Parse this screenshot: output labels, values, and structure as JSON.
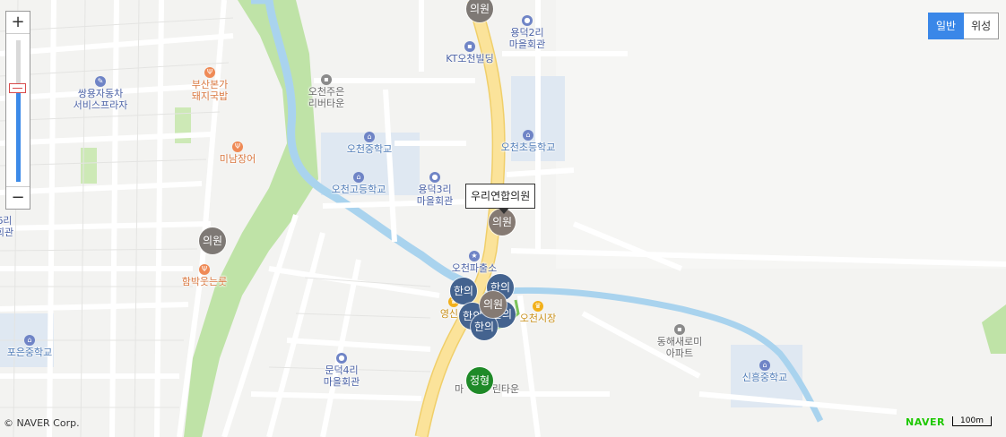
{
  "map_type": {
    "normal": "일반",
    "satellite": "위성"
  },
  "zoom": {
    "zoom_in": "+",
    "zoom_out": "−"
  },
  "copyright": "© NAVER Corp.",
  "brand": "NAVER",
  "scale_label": "100m",
  "tooltip": "우리연합의원",
  "colors": {
    "accent": "#3a87e8",
    "water": "#a9d3ee",
    "park": "#bfe3a7",
    "main_road": "#fbe39a"
  },
  "pois": [
    {
      "id": "ssangyong",
      "line1": "쌍용자동차",
      "line2": "서비스프라자",
      "icon": "wrench-icon",
      "color": "blue"
    },
    {
      "id": "busan",
      "line1": "부산본가",
      "line2": "돼지국밥",
      "icon": "fork-knife-icon",
      "color": "orange"
    },
    {
      "id": "minam",
      "line1": "미남장어",
      "line2": "",
      "icon": "fork-knife-icon",
      "color": "orange"
    },
    {
      "id": "hambak",
      "line1": "함박웃는룻",
      "line2": "",
      "icon": "fork-knife-icon",
      "color": "orange"
    },
    {
      "id": "ocheon_jueun",
      "line1": "오천주은",
      "line2": "리버타운",
      "icon": "building-icon",
      "color": "gray"
    },
    {
      "id": "ocheon_middle",
      "line1": "오천중학교",
      "line2": "",
      "icon": "school-icon",
      "color": "lblue"
    },
    {
      "id": "ocheon_high",
      "line1": "오천고등학교",
      "line2": "",
      "icon": "school-icon",
      "color": "lblue"
    },
    {
      "id": "yongdeok3",
      "line1": "용덕3리",
      "line2": "마을회관",
      "icon": "pin-icon",
      "color": "blue"
    },
    {
      "id": "yongdeok2",
      "line1": "용덕2리",
      "line2": "마을회관",
      "icon": "pin-icon",
      "color": "blue"
    },
    {
      "id": "kt",
      "line1": "KT오천빌딩",
      "line2": "",
      "icon": "building-icon",
      "color": "blue"
    },
    {
      "id": "ocheon_elem",
      "line1": "오천초등학교",
      "line2": "",
      "icon": "school-icon",
      "color": "lblue"
    },
    {
      "id": "police",
      "line1": "오천파출소",
      "line2": "",
      "icon": "police-icon",
      "color": "blue"
    },
    {
      "id": "ocheon_market",
      "line1": "오천시장",
      "line2": "",
      "icon": "crown-icon",
      "color": "gold"
    },
    {
      "id": "yeongsin",
      "line1": "영신상",
      "line2": "",
      "icon": "crown-icon",
      "color": "gold"
    },
    {
      "id": "donghae",
      "line1": "동해새로미",
      "line2": "아파트",
      "icon": "building-icon",
      "color": "gray"
    },
    {
      "id": "sinheung",
      "line1": "신흥중학교",
      "line2": "",
      "icon": "school-icon",
      "color": "lblue"
    },
    {
      "id": "poeun",
      "line1": "포은중학교",
      "line2": "",
      "icon": "school-icon",
      "color": "lblue"
    },
    {
      "id": "mundeok4",
      "line1": "문덕4리",
      "line2": "마을회관",
      "icon": "pin-icon",
      "color": "blue"
    },
    {
      "id": "town",
      "line1": "마",
      "line2": "",
      "icon": "",
      "color": "gray"
    },
    {
      "id": "town2",
      "line1": "린타운",
      "line2": "",
      "icon": "",
      "color": "gray"
    },
    {
      "id": "left6",
      "line1": "6리",
      "line2": "회관",
      "icon": "",
      "color": "blue"
    }
  ],
  "markers": [
    {
      "id": "top",
      "label": "의원",
      "kind": "clinic"
    },
    {
      "id": "wuri",
      "label": "의원",
      "kind": "clinic"
    },
    {
      "id": "left",
      "label": "의원",
      "kind": "clinic"
    },
    {
      "id": "h1",
      "label": "한의",
      "kind": "oriental"
    },
    {
      "id": "h2",
      "label": "한의",
      "kind": "oriental"
    },
    {
      "id": "h3",
      "label": "한의",
      "kind": "oriental"
    },
    {
      "id": "h4",
      "label": "한의",
      "kind": "oriental"
    },
    {
      "id": "h5",
      "label": "한의",
      "kind": "oriental"
    },
    {
      "id": "mid",
      "label": "의원",
      "kind": "clinic"
    },
    {
      "id": "ortho",
      "label": "정형",
      "kind": "orthopedic"
    }
  ]
}
